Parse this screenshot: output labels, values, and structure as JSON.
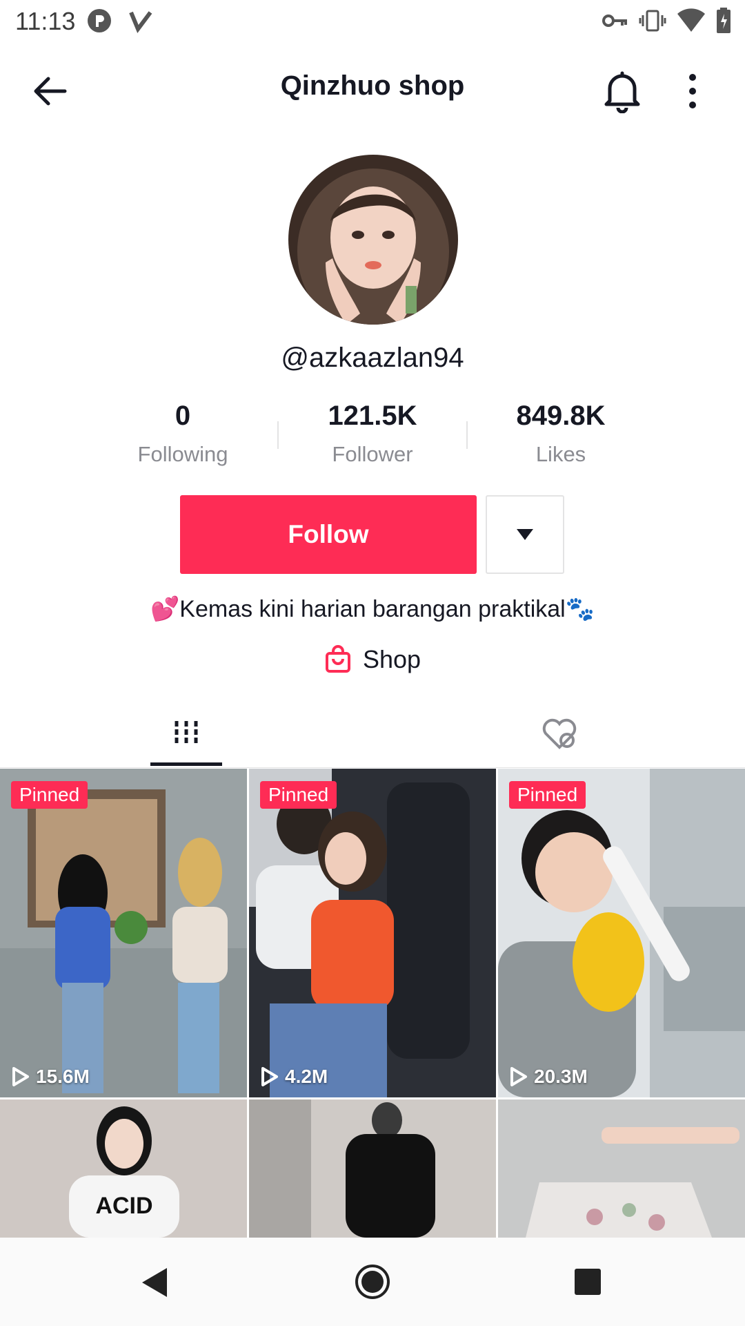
{
  "status_bar": {
    "time": "11:13"
  },
  "header": {
    "title": "Qinzhuo shop"
  },
  "profile": {
    "username": "@azkaazlan94",
    "stats": [
      {
        "value": "0",
        "label": "Following"
      },
      {
        "value": "121.5K",
        "label": "Follower"
      },
      {
        "value": "849.8K",
        "label": "Likes"
      }
    ],
    "follow_label": "Follow",
    "bio": "💕Kemas kini harian barangan praktikal🐾",
    "shop_label": "Shop"
  },
  "colors": {
    "accent": "#fe2c55",
    "text": "#161823",
    "muted": "#8a8b91"
  },
  "videos": [
    {
      "pinned": "Pinned",
      "views": "15.6M"
    },
    {
      "pinned": "Pinned",
      "views": "4.2M"
    },
    {
      "pinned": "Pinned",
      "views": "20.3M"
    },
    {
      "views": ""
    },
    {
      "views": ""
    },
    {
      "views": ""
    }
  ]
}
